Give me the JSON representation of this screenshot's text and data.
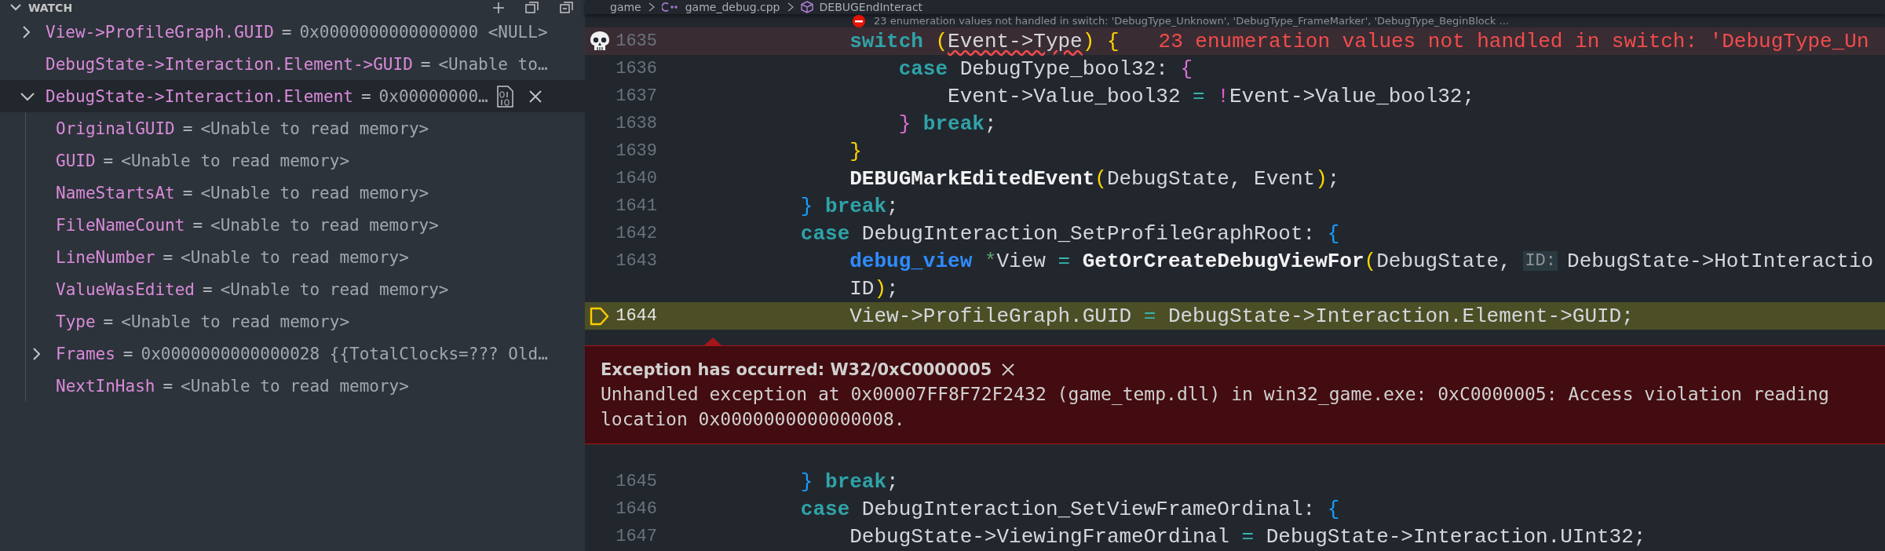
{
  "watch": {
    "title": "WATCH",
    "items": [
      {
        "name": "View->ProfileGraph.GUID",
        "separator": "=",
        "value": "0x0000000000000000 <NULL>",
        "expanded": false,
        "selected": false
      },
      {
        "name": "DebugState->Interaction.Element->GUID",
        "separator": "=",
        "value": "<Unable to…",
        "selected": false
      },
      {
        "name": "DebugState->Interaction.Element",
        "separator": "=",
        "value": "0x00000000…",
        "expanded": true,
        "selected": true,
        "children": [
          {
            "name": "OriginalGUID",
            "separator": "=",
            "value": "<Unable to read memory>",
            "selected": false
          },
          {
            "name": "GUID",
            "separator": "=",
            "value": "<Unable to read memory>",
            "selected": false
          },
          {
            "name": "NameStartsAt",
            "separator": "=",
            "value": "<Unable to read memory>",
            "selected": false
          },
          {
            "name": "FileNameCount",
            "separator": "=",
            "value": "<Unable to read memory>",
            "selected": false
          },
          {
            "name": "LineNumber",
            "separator": "=",
            "value": "<Unable to read memory>",
            "selected": false
          },
          {
            "name": "ValueWasEdited",
            "separator": "=",
            "value": "<Unable to read memory>",
            "selected": false
          },
          {
            "name": "Type",
            "separator": "=",
            "value": "<Unable to read memory>",
            "selected": false
          },
          {
            "name": "Frames",
            "separator": "=",
            "value": "0x0000000000000028 {{TotalClocks=??? Old…",
            "expanded": false,
            "selected": false
          },
          {
            "name": "NextInHash",
            "separator": "=",
            "value": "<Unable to read memory>",
            "selected": false
          }
        ]
      }
    ]
  },
  "editor": {
    "breadcrumb": [
      "game",
      "game_debug.cpp",
      "DEBUGEndInteract"
    ],
    "hover_hint": "23 enumeration values not handled in switch: 'DebugType_Unknown', 'DebugType_FrameMarker', 'DebugType_BeginBlock ...",
    "lines": [
      {
        "kind": "code",
        "number": "1635",
        "gutter": {
          "kind": "skull"
        },
        "error": true,
        "highlighted": false,
        "diagnostic": "23 enumeration values not handled in switch: 'DebugType_Un",
        "tokens": [
          {
            "kind": "kw",
            "text": "            switch"
          },
          {
            "kind": "b1",
            "text": " ("
          },
          {
            "kind": "err",
            "text": "Event->Type"
          },
          {
            "kind": "b1",
            "text": ")"
          },
          {
            "kind": "b1",
            "text": " {"
          }
        ]
      },
      {
        "kind": "code",
        "number": "1636",
        "error": false,
        "highlighted": false,
        "tokens": [
          {
            "kind": "kw",
            "text": "                case"
          },
          {
            "kind": "p",
            "text": " DebugType_bool32: "
          },
          {
            "kind": "b2",
            "text": "{"
          }
        ]
      },
      {
        "kind": "code",
        "number": "1637",
        "error": false,
        "highlighted": false,
        "tokens": [
          {
            "kind": "p",
            "text": "                    Event->Value_bool32 "
          },
          {
            "kind": "op",
            "text": "="
          },
          {
            "kind": "not",
            "text": " !"
          },
          {
            "kind": "p",
            "text": "Event->Value_bool32;"
          }
        ]
      },
      {
        "kind": "code",
        "number": "1638",
        "error": false,
        "highlighted": false,
        "tokens": [
          {
            "kind": "b2",
            "text": "                }"
          },
          {
            "kind": "kw",
            "text": " break"
          },
          {
            "kind": "p",
            "text": ";"
          }
        ]
      },
      {
        "kind": "code",
        "number": "1639",
        "error": false,
        "highlighted": false,
        "tokens": [
          {
            "kind": "b1",
            "text": "            }"
          }
        ]
      },
      {
        "kind": "code",
        "number": "1640",
        "error": false,
        "highlighted": false,
        "tokens": [
          {
            "kind": "fn",
            "text": "            DEBUGMarkEditedEvent"
          },
          {
            "kind": "b1",
            "text": "("
          },
          {
            "kind": "p",
            "text": "DebugState, Event"
          },
          {
            "kind": "b1",
            "text": ")"
          },
          {
            "kind": "p",
            "text": ";"
          }
        ]
      },
      {
        "kind": "code",
        "number": "1641",
        "error": false,
        "highlighted": false,
        "tokens": [
          {
            "kind": "b3",
            "text": "        }"
          },
          {
            "kind": "kw",
            "text": " break"
          },
          {
            "kind": "p",
            "text": ";"
          }
        ]
      },
      {
        "kind": "code",
        "number": "1642",
        "error": false,
        "highlighted": false,
        "tokens": [
          {
            "kind": "kw",
            "text": "        case"
          },
          {
            "kind": "p",
            "text": " DebugInteraction_SetProfileGraphRoot: "
          },
          {
            "kind": "b3",
            "text": "{"
          }
        ]
      },
      {
        "kind": "code",
        "number": "1643",
        "error": false,
        "highlighted": false,
        "tokens": [
          {
            "kind": "type",
            "text": "            debug_view"
          },
          {
            "kind": "ptr",
            "text": " *"
          },
          {
            "kind": "p",
            "text": "View "
          },
          {
            "kind": "op",
            "text": "="
          },
          {
            "kind": "fn",
            "text": " GetOrCreateDebugViewFor"
          },
          {
            "kind": "b1",
            "text": "("
          },
          {
            "kind": "p",
            "text": "DebugState, "
          },
          {
            "kind": "hint",
            "text": "ID:"
          },
          {
            "kind": "p",
            "text": "DebugState->HotInteractio"
          }
        ]
      },
      {
        "kind": "code",
        "error": false,
        "highlighted": false,
        "tokens": [
          {
            "kind": "p",
            "text": "            ID"
          },
          {
            "kind": "b1",
            "text": ")"
          },
          {
            "kind": "p",
            "text": ";"
          }
        ]
      },
      {
        "kind": "code",
        "number": "1644",
        "gutter": {
          "kind": "current"
        },
        "error": false,
        "highlighted": true,
        "tokens": [
          {
            "kind": "p",
            "text": "            View->ProfileGraph.GUID "
          },
          {
            "kind": "op",
            "text": "="
          },
          {
            "kind": "p",
            "text": " DebugState->Interaction.Element->GUID;"
          }
        ]
      },
      {
        "kind": "exception",
        "title": "Exception has occurred: W32/0xC0000005",
        "message": [
          "Unhandled exception at 0x00007FF8F72F2432 (game_temp.dll) in win32_game.exe: 0xC0000005: Access violation reading",
          "location 0x0000000000000008."
        ]
      },
      {
        "kind": "code",
        "number": "1645",
        "error": false,
        "highlighted": false,
        "tokens": [
          {
            "kind": "b3",
            "text": "        }"
          },
          {
            "kind": "kw",
            "text": " break"
          },
          {
            "kind": "p",
            "text": ";"
          }
        ]
      },
      {
        "kind": "code",
        "number": "1646",
        "error": false,
        "highlighted": false,
        "tokens": [
          {
            "kind": "kw",
            "text": "        case"
          },
          {
            "kind": "p",
            "text": " DebugInteraction_SetViewFrameOrdinal: "
          },
          {
            "kind": "b3",
            "text": "{"
          }
        ]
      },
      {
        "kind": "code",
        "number": "1647",
        "error": false,
        "highlighted": false,
        "tokens": [
          {
            "kind": "p",
            "text": "            DebugState->ViewingFrameOrdinal "
          },
          {
            "kind": "op",
            "text": "="
          },
          {
            "kind": "p",
            "text": " DebugState->Interaction.UInt32;"
          }
        ]
      }
    ]
  }
}
